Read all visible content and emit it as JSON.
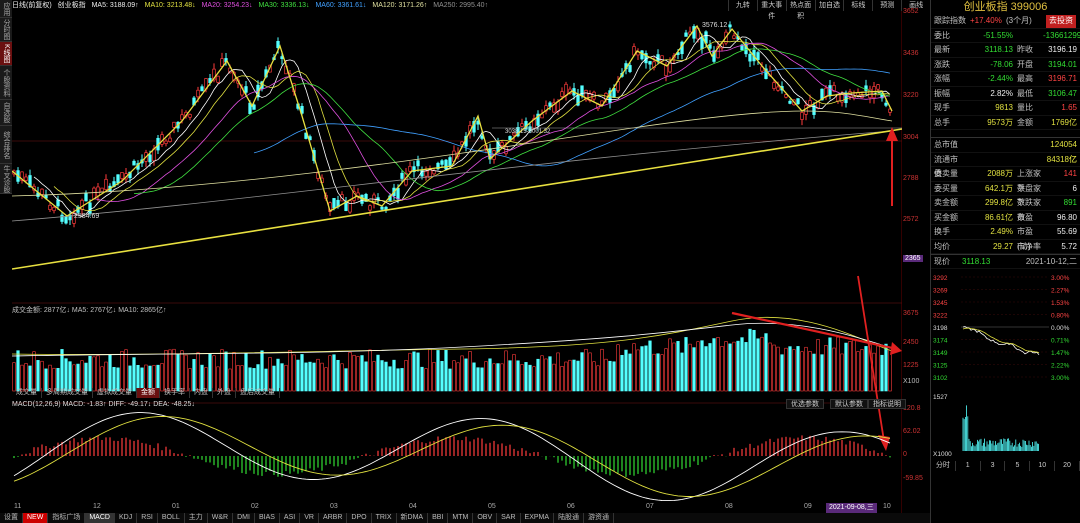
{
  "left_tabs": [
    "应用",
    "分时图",
    "K线图",
    "个股资料",
    "自选股",
    "综合排名",
    "牛叉诊股"
  ],
  "left_tab_active": 2,
  "header": {
    "period": "日线(前复权)",
    "indicator": "创业板指",
    "ma5": "MA5: 3188.09↑",
    "ma10": "MA10: 3213.48↓",
    "ma20": "MA20: 3254.23↓",
    "ma30": "MA30: 3336.13↓",
    "ma60": "MA60: 3361.61↓",
    "ma120": "MA120: 3171.26↑",
    "ma250": "MA250: 2995.40↑"
  },
  "toolbar": [
    "九转",
    "重大事件",
    "热点面积",
    "加自选",
    "标线",
    "预测",
    "画线"
  ],
  "price_axis": [
    "3652",
    "3436",
    "3220",
    "3004",
    "2788",
    "2572",
    "2365"
  ],
  "price_labels": {
    "high": "3576.12",
    "low": "2584.69",
    "mid": "3038.15-3001.32"
  },
  "volume": {
    "header": "成交金额: 2877亿↓ MA5: 2767亿↓ MA10: 2865亿↑",
    "axis": [
      "3675",
      "2450",
      "1225",
      "X100"
    ]
  },
  "vol_tabs": [
    "成交量",
    "多周期成交量",
    "虚拟成交量",
    "金额",
    "换手率",
    "内盘",
    "外盘",
    "盘后成交量"
  ],
  "vol_tab_active": 3,
  "macd": {
    "header": "MACD(12,26,9) MACD: -1.83↑ DIFF: -49.17↓ DEA: -48.25↓",
    "axis": [
      "120.8",
      "62.02",
      "0",
      "-59.85"
    ],
    "buttons": [
      "优选参数",
      "默认参数",
      "指标说明"
    ]
  },
  "x_axis": [
    "11",
    "12",
    "01",
    "02",
    "03",
    "04",
    "05",
    "06",
    "07",
    "08",
    "09",
    "10"
  ],
  "date_label": "2021-09-08,三",
  "bottom_tabs": [
    "设置",
    "NEW",
    "指标广场",
    "MACD",
    "KDJ",
    "RSI",
    "BOLL",
    "主力",
    "W&R",
    "DMI",
    "BIAS",
    "ASI",
    "VR",
    "ARBR",
    "DPO",
    "TRIX",
    "新DMA",
    "BBI",
    "MTM",
    "OBV",
    "SAR",
    "EXPMA",
    "陆股通",
    "游资通"
  ],
  "panel": {
    "title": "创业板指 399006",
    "track": {
      "label": "跟踪指数",
      "value": "+17.40%",
      "period": "(3个月)",
      "btn": "去投资"
    },
    "rows": [
      {
        "l1": "委比",
        "v1": "-51.55%",
        "c1": "green",
        "l2": "",
        "v2": "-13661299",
        "c2": "green"
      },
      {
        "l1": "最新",
        "v1": "3118.13",
        "c1": "green",
        "l2": "昨收",
        "v2": "3196.19",
        "c2": "white"
      },
      {
        "l1": "涨跌",
        "v1": "-78.06",
        "c1": "green",
        "l2": "开盘",
        "v2": "3194.01",
        "c2": "green"
      },
      {
        "l1": "涨幅",
        "v1": "-2.44%",
        "c1": "green",
        "l2": "最高",
        "v2": "3196.71",
        "c2": "red"
      },
      {
        "l1": "振幅",
        "v1": "2.82%",
        "c1": "white",
        "l2": "最低",
        "v2": "3106.47",
        "c2": "green"
      },
      {
        "l1": "现手",
        "v1": "9813",
        "c1": "yellow",
        "l2": "量比",
        "v2": "1.65",
        "c2": "red"
      },
      {
        "l1": "总手",
        "v1": "9573万",
        "c1": "yellow",
        "l2": "金额",
        "v2": "1769亿",
        "c2": "yellow"
      }
    ],
    "rows2": [
      {
        "l1": "总市值",
        "v1": "",
        "l2": "",
        "v2": "124054亿",
        "c2": "yellow"
      },
      {
        "l1": "流通市值",
        "v1": "",
        "l2": "",
        "v2": "84318亿",
        "c2": "yellow"
      },
      {
        "l1": "委卖量",
        "v1": "2088万",
        "c1": "yellow",
        "l2": "上涨家数",
        "v2": "141",
        "c2": "red"
      },
      {
        "l1": "委买量",
        "v1": "642.1万",
        "c1": "yellow",
        "l2": "平盘家数",
        "v2": "6",
        "c2": "white"
      },
      {
        "l1": "卖金额",
        "v1": "299.8亿",
        "c1": "yellow",
        "l2": "下跌家数",
        "v2": "891",
        "c2": "green"
      },
      {
        "l1": "买金额",
        "v1": "86.61亿",
        "c1": "yellow",
        "l2": "市盈",
        "v2": "96.80",
        "c2": "white"
      },
      {
        "l1": "换手",
        "v1": "2.49%",
        "c1": "yellow",
        "l2": "市盈(动)",
        "v2": "55.69",
        "c2": "white"
      },
      {
        "l1": "均价",
        "v1": "29.27",
        "c1": "yellow",
        "l2": "市净率",
        "v2": "5.72",
        "c2": "white"
      }
    ],
    "intraday": {
      "price_label": "现价",
      "price": "3118.13",
      "date": "2021-10-12,二",
      "left_axis": [
        "3292",
        "3269",
        "3245",
        "3222",
        "3198",
        "3174",
        "3149",
        "3125",
        "3102"
      ],
      "right_axis": [
        "3.00%",
        "2.27%",
        "1.53%",
        "0.80%",
        "0.00%",
        "0.71%",
        "1.47%",
        "2.22%",
        "3.00%"
      ],
      "vol_axis": [
        "1527",
        "X1000"
      ],
      "bottom_tabs": [
        "分时",
        "1",
        "3",
        "5",
        "10",
        "20"
      ]
    }
  },
  "colors": {
    "up": "#ff3c3c",
    "down": "#54ffff",
    "yellow": "#e8e040",
    "arrow": "#e02020"
  }
}
